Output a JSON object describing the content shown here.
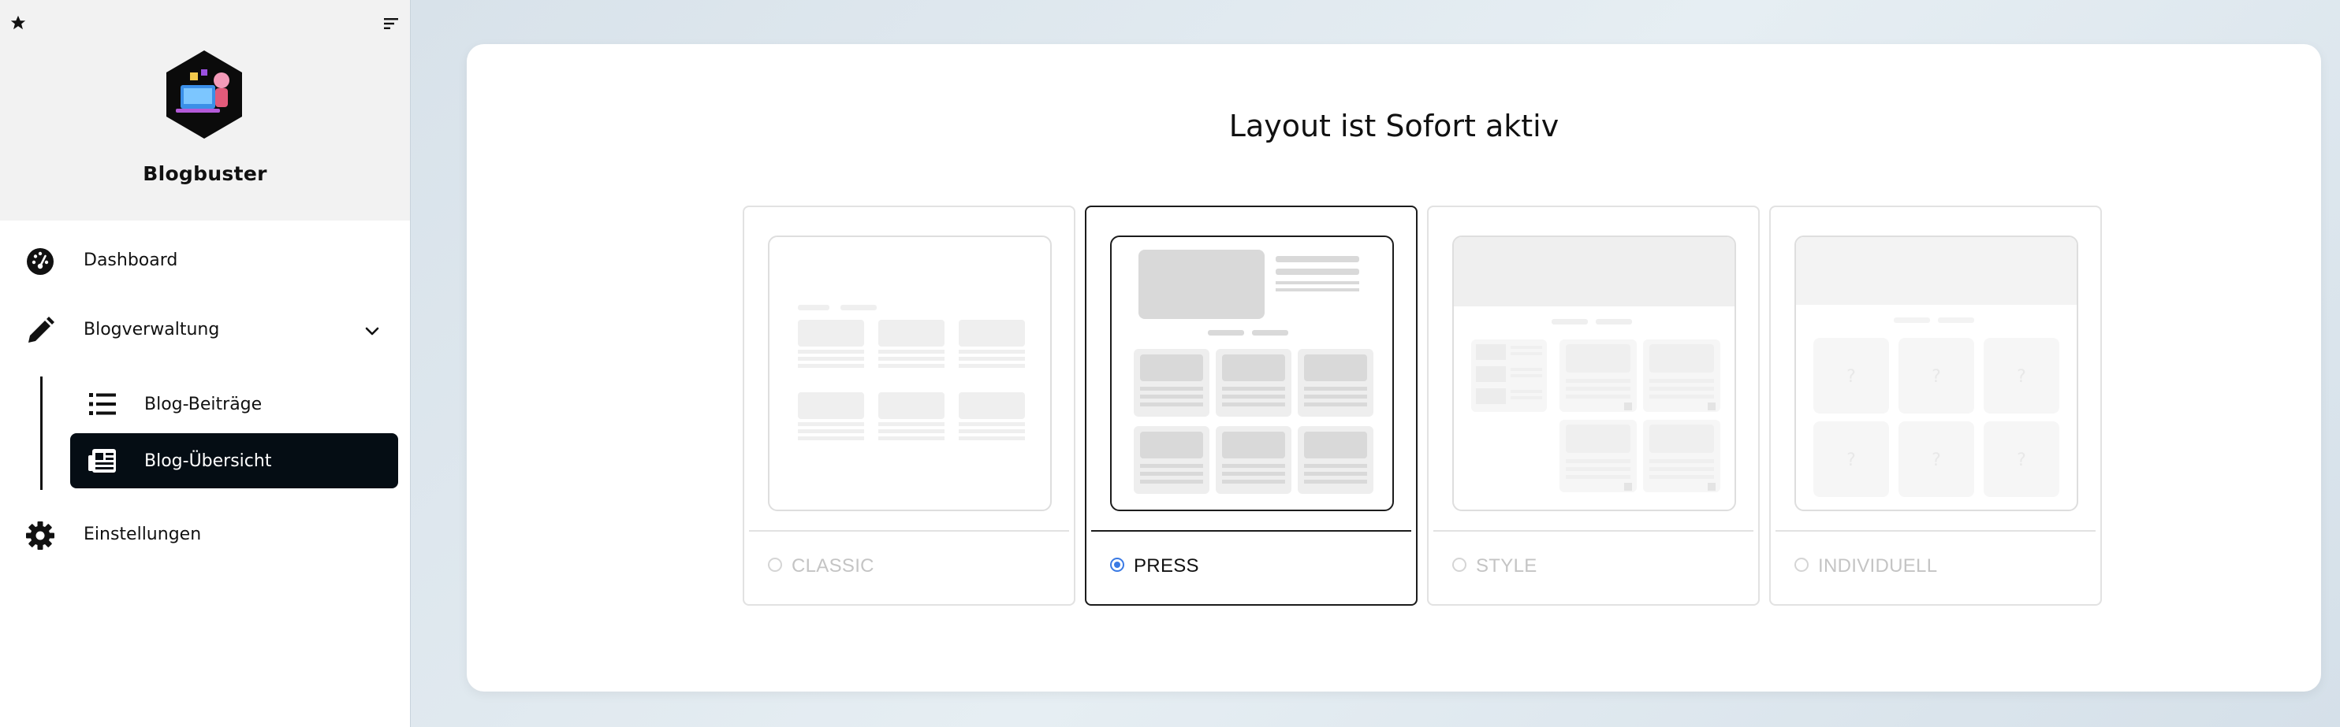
{
  "sidebar": {
    "brand": "Blogbuster",
    "nav": {
      "dashboard": "Dashboard",
      "blog_management": "Blogverwaltung",
      "posts": "Blog-Beiträge",
      "overview": "Blog-Übersicht",
      "settings": "Einstellungen"
    }
  },
  "main": {
    "title": "Layout ist Sofort aktiv",
    "layouts": [
      {
        "label": "CLASSIC",
        "selected": false
      },
      {
        "label": "PRESS",
        "selected": true
      },
      {
        "label": "STYLE",
        "selected": false
      },
      {
        "label": "INDIVIDUELL",
        "selected": false
      }
    ]
  },
  "colors": {
    "accent": "#3a7ae4",
    "active_nav_bg": "#050d14",
    "page_bg": "#dbe5ed"
  }
}
